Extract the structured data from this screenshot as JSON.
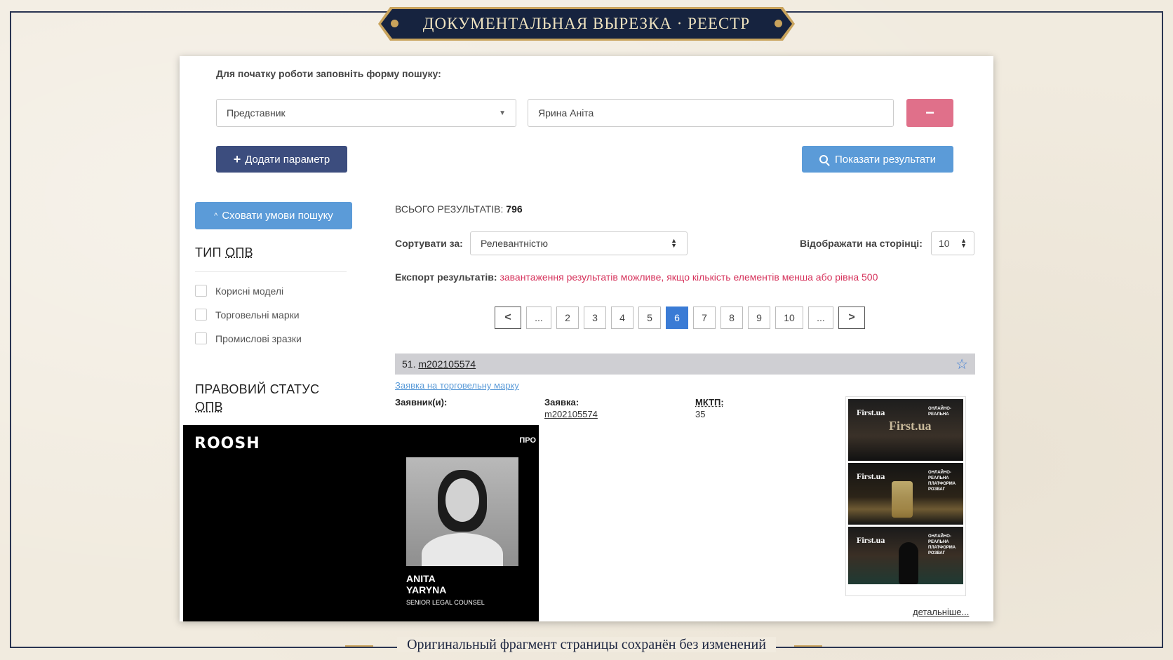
{
  "banner": {
    "title": "ДОКУМЕНТАЛЬНАЯ ВЫРЕЗКА · РЕЕСТР"
  },
  "footer": {
    "caption": "Оригинальный фрагмент страницы сохранён без изменений"
  },
  "search": {
    "instruction": "Для початку роботи заповніть форму пошуку:",
    "param_select": "Представник",
    "param_value": "Ярина Аніта",
    "remove_label": "−",
    "add_param_label": "Додати параметр",
    "show_results_label": "Показати результати",
    "hide_conditions_label": "Сховати умови пошуку"
  },
  "filters": {
    "type_heading_prefix": "ТИП ",
    "type_heading_abbr": "ОПВ",
    "types": [
      "Корисні моделі",
      "Торговельні марки",
      "Промислові зразки"
    ],
    "status_heading_line1": "ПРАВОВИЙ СТАТУС",
    "status_heading_abbr": "ОПВ"
  },
  "results": {
    "total_label": "ВСЬОГО РЕЗУЛЬТАТІВ:",
    "total_value": "796",
    "sort_label": "Сортувати за:",
    "sort_value": "Релевантністю",
    "per_page_label": "Відображати на сторінці:",
    "per_page_value": "10",
    "export_label": "Експорт результатів:",
    "export_note": "завантаження результатів можливе, якщо кількість елементів менша або рівна 500",
    "pages": [
      "...",
      "2",
      "3",
      "4",
      "5",
      "6",
      "7",
      "8",
      "9",
      "10",
      "..."
    ],
    "active_page": "6"
  },
  "item": {
    "index": "51.",
    "number": "m202105574",
    "type_link": "Заявка на торговельну марку",
    "applicant_label": "Заявник(и):",
    "application_label": "Заявка:",
    "application_value": "m202105574",
    "mktp_label": "МКТП:",
    "mktp_value": "35",
    "details_link": "детальніше...",
    "thumb_brand": "First.ua",
    "thumb_brand_large": "First.ua",
    "thumb_texts": [
      "ОНЛАЙНО-РЕАЛЬНА",
      "ОНЛАЙНО-РЕАЛЬНА ПЛАТФОРМА РОЗВАГ",
      "ОНЛАЙНО-РЕАЛЬНА ПЛАТФОРМА РОЗВАГ"
    ]
  },
  "overlay": {
    "logo": "ROOSH",
    "corner": "ПРО",
    "name_line1": "ANITA",
    "name_line2": "YARYNA",
    "role": "SENIOR LEGAL COUNSEL"
  },
  "colors": {
    "navy": "#3c4d7e",
    "blue": "#5b9bd8",
    "pink": "#e0708a",
    "active_page": "#3a7bd5",
    "export_note": "#d6335c",
    "frame": "#2a3552",
    "gold": "#c9a35c"
  }
}
